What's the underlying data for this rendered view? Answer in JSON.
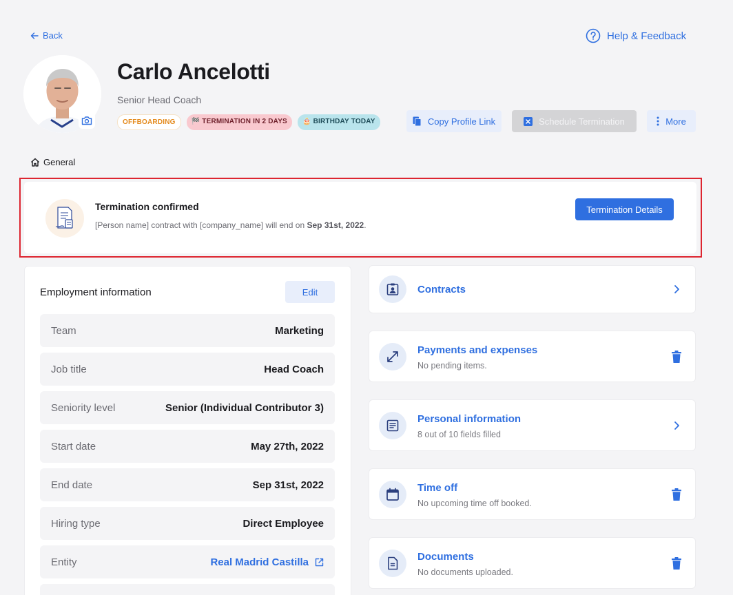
{
  "header": {
    "back_label": "Back",
    "help_label": "Help & Feedback"
  },
  "profile": {
    "name": "Carlo Ancelotti",
    "role": "Senior Head Coach",
    "badges": {
      "offboarding": "OFFBOARDING",
      "termination": "🏁 TERMINATION IN 2 DAYS",
      "birthday": "🎂 BIRTHDAY TODAY"
    }
  },
  "actions": {
    "copy_profile_link": "Copy Profile Link",
    "schedule_termination": "Schedule Termination",
    "more": "More"
  },
  "breadcrumb": {
    "general": "General"
  },
  "alert": {
    "title": "Termination confirmed",
    "message_prefix": "[Person name] contract with [company_name] will end on ",
    "message_date": "Sep 31st, 2022",
    "message_suffix": ".",
    "button": "Termination Details"
  },
  "employment": {
    "title": "Employment information",
    "edit_label": "Edit",
    "rows": [
      {
        "label": "Team",
        "value": "Marketing"
      },
      {
        "label": "Job title",
        "value": "Head Coach"
      },
      {
        "label": "Seniority level",
        "value": "Senior (Individual Contributor 3)"
      },
      {
        "label": "Start date",
        "value": "May 27th, 2022"
      },
      {
        "label": "End date",
        "value": "Sep 31st, 2022"
      },
      {
        "label": "Hiring type",
        "value": "Direct Employee"
      },
      {
        "label": "Entity",
        "value": "Real Madrid Castilla"
      }
    ]
  },
  "sections": {
    "contracts": {
      "title": "Contracts"
    },
    "payments": {
      "title": "Payments and expenses",
      "subtitle": "No pending items."
    },
    "personal": {
      "title": "Personal information",
      "subtitle": "8 out of 10 fields filled"
    },
    "timeoff": {
      "title": "Time off",
      "subtitle": "No upcoming time off booked."
    },
    "documents": {
      "title": "Documents",
      "subtitle": "No documents uploaded."
    }
  },
  "colors": {
    "accent": "#2f6fe0",
    "background": "#f4f4f6",
    "alert_outline": "#dd2530",
    "badge_offboarding": "#e48a1c",
    "badge_termination_bg": "#f9c9cf",
    "badge_birthday_bg": "#b9e4ec"
  },
  "icons": {
    "back": "arrow-left-icon",
    "help": "question-circle-icon",
    "camera": "camera-icon",
    "copy": "copy-icon",
    "schedule": "close-square-icon",
    "more": "more-vertical-icon",
    "home": "home-icon",
    "termination": "document-signature-icon",
    "external": "external-link-icon",
    "contracts": "id-badge-icon",
    "payments": "arrows-diagonal-icon",
    "personal": "document-lines-icon",
    "timeoff": "calendar-icon",
    "documents": "file-icon",
    "chevron": "chevron-right-icon",
    "trash": "trash-icon"
  }
}
